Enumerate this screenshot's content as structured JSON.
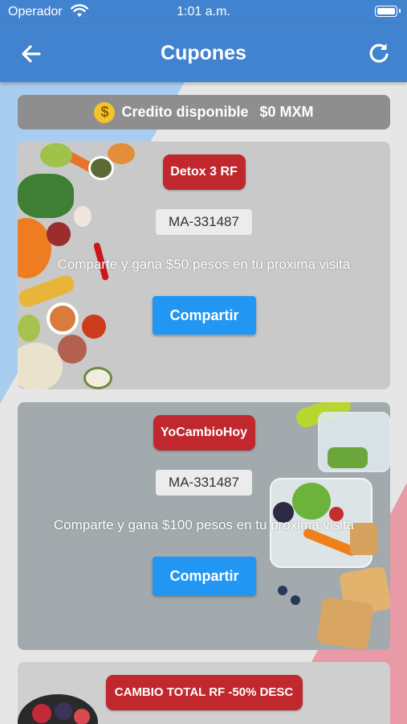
{
  "status_bar": {
    "carrier": "Operador",
    "time": "1:01 a.m."
  },
  "nav": {
    "title": "Cupones",
    "back_icon": "arrow-left-icon",
    "refresh_icon": "refresh-icon"
  },
  "credit": {
    "coin_symbol": "$",
    "label": "Credito disponible",
    "value": "$0 MXM"
  },
  "coupons": [
    {
      "name": "Detox 3 RF",
      "code": "MA-331487",
      "description": "Comparte y gana $50 pesos en tu proxima visita",
      "button": "Compartir"
    },
    {
      "name": "YoCambioHoy",
      "code": "MA-331487",
      "description": "Comparte y gana $100 pesos en tu proxima visita",
      "button": "Compartir"
    },
    {
      "name": "CAMBIO TOTAL RF -50% DESC"
    }
  ],
  "colors": {
    "header": "#4283cf",
    "badge": "#c0282d",
    "button": "#2196f3",
    "credit_bar": "#8e8e8e",
    "coin": "#f4c22b"
  }
}
